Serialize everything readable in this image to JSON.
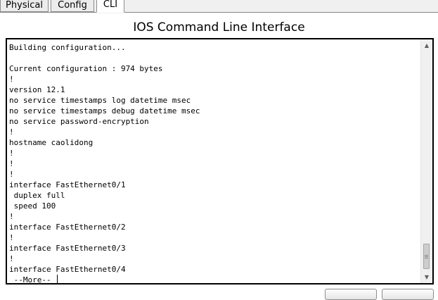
{
  "tabs": [
    {
      "label": "Physical",
      "active": false
    },
    {
      "label": "Config",
      "active": false
    },
    {
      "label": "CLI",
      "active": true
    }
  ],
  "panel_title": "IOS Command Line Interface",
  "console": {
    "lines": [
      "Building configuration...",
      "",
      "Current configuration : 974 bytes",
      "!",
      "version 12.1",
      "no service timestamps log datetime msec",
      "no service timestamps debug datetime msec",
      "no service password-encryption",
      "!",
      "hostname caolidong",
      "!",
      "!",
      "!",
      "interface FastEthernet0/1",
      " duplex full",
      " speed 100",
      "!",
      "interface FastEthernet0/2",
      "!",
      "interface FastEthernet0/3",
      "!",
      "interface FastEthernet0/4",
      " --More-- "
    ]
  },
  "icons": {
    "scroll_up": "scroll-up-arrow-icon",
    "scroll_down": "scroll-down-arrow-icon"
  },
  "colors": {
    "console_border": "#000000",
    "console_bg": "#ffffff",
    "tab_bg": "#ececec"
  }
}
